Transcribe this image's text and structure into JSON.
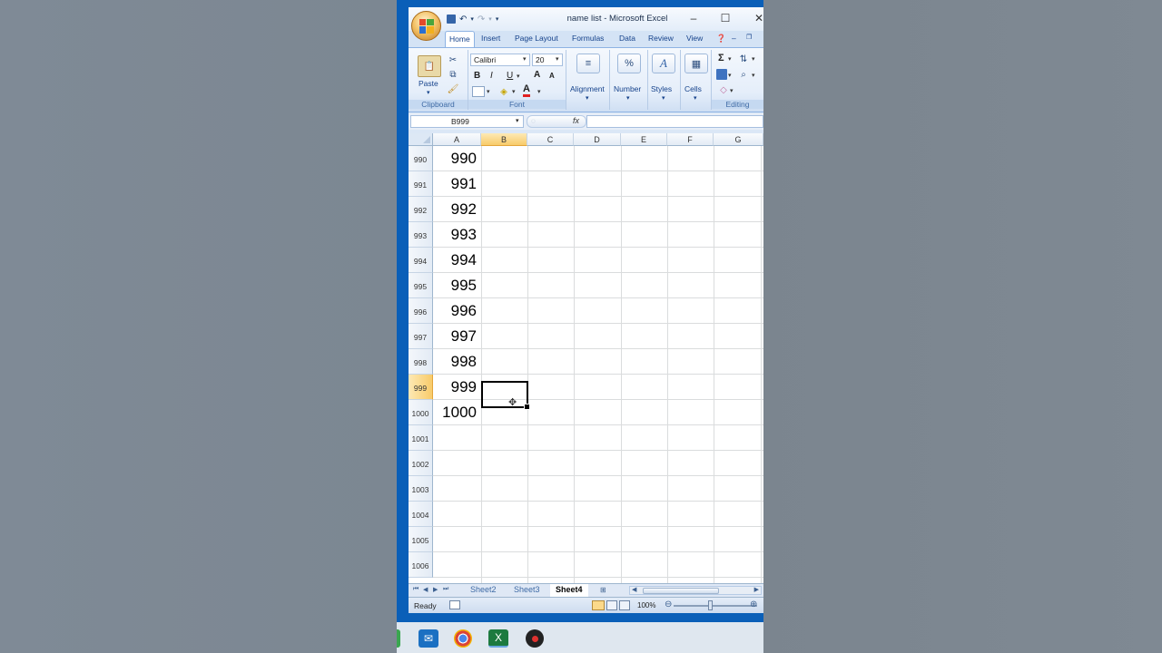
{
  "window": {
    "title": "name list - Microsoft Excel",
    "controls": [
      "–",
      "☐",
      "✕"
    ]
  },
  "ribbon_tabs": [
    "Home",
    "Insert",
    "Page Layout",
    "Formulas",
    "Data",
    "Review",
    "View"
  ],
  "active_tab": "Home",
  "ribbon": {
    "clipboard": {
      "paste_label": "Paste",
      "group_label": "Clipboard"
    },
    "font": {
      "family": "Calibri",
      "size": "20",
      "group_label": "Font",
      "bold": "B",
      "italic": "I",
      "underline": "U"
    },
    "alignment_label": "Alignment",
    "number_label": "Number",
    "styles_label": "Styles",
    "cells_label": "Cells",
    "editing_label": "Editing",
    "number_symbol": "%",
    "sigma_symbol": "Σ"
  },
  "formula_bar": {
    "name_box": "B999",
    "fx": "fx",
    "formula": ""
  },
  "columns": [
    "A",
    "B",
    "C",
    "D",
    "E",
    "F",
    "G"
  ],
  "selected_column": "B",
  "rows": [
    {
      "num": "990",
      "a": "990"
    },
    {
      "num": "991",
      "a": "991"
    },
    {
      "num": "992",
      "a": "992"
    },
    {
      "num": "993",
      "a": "993"
    },
    {
      "num": "994",
      "a": "994"
    },
    {
      "num": "995",
      "a": "995"
    },
    {
      "num": "996",
      "a": "996"
    },
    {
      "num": "997",
      "a": "997"
    },
    {
      "num": "998",
      "a": "998"
    },
    {
      "num": "999",
      "a": "999"
    },
    {
      "num": "1000",
      "a": "1000"
    },
    {
      "num": "1001",
      "a": ""
    },
    {
      "num": "1002",
      "a": ""
    },
    {
      "num": "1003",
      "a": ""
    },
    {
      "num": "1004",
      "a": ""
    },
    {
      "num": "1005",
      "a": ""
    },
    {
      "num": "1006",
      "a": ""
    }
  ],
  "selected_row": "999",
  "sheet_tabs": [
    "Sheet2",
    "Sheet3",
    "Sheet4"
  ],
  "active_sheet": "Sheet4",
  "status": {
    "ready": "Ready",
    "zoom": "100%"
  },
  "colors": {
    "accent": "#15428b",
    "selection": "#f8cb6a",
    "taskbar_blue": "#0a5fb8"
  }
}
